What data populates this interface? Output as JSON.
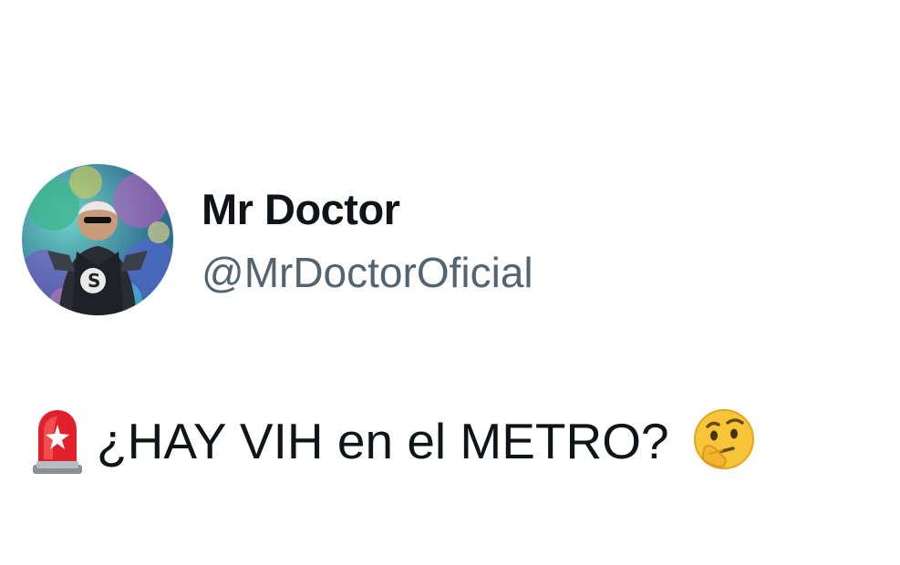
{
  "author": {
    "display_name": "Mr Doctor",
    "handle": "@MrDoctorOficial",
    "avatar_icon": "profile-photo-avatar"
  },
  "tweet": {
    "text": "¿HAY VIH en el METRO?",
    "leading_emoji": "police-car-light-icon",
    "trailing_emoji": "thinking-face-icon"
  },
  "colors": {
    "text": "#0f1419",
    "handle": "#536471",
    "background": "#ffffff"
  }
}
